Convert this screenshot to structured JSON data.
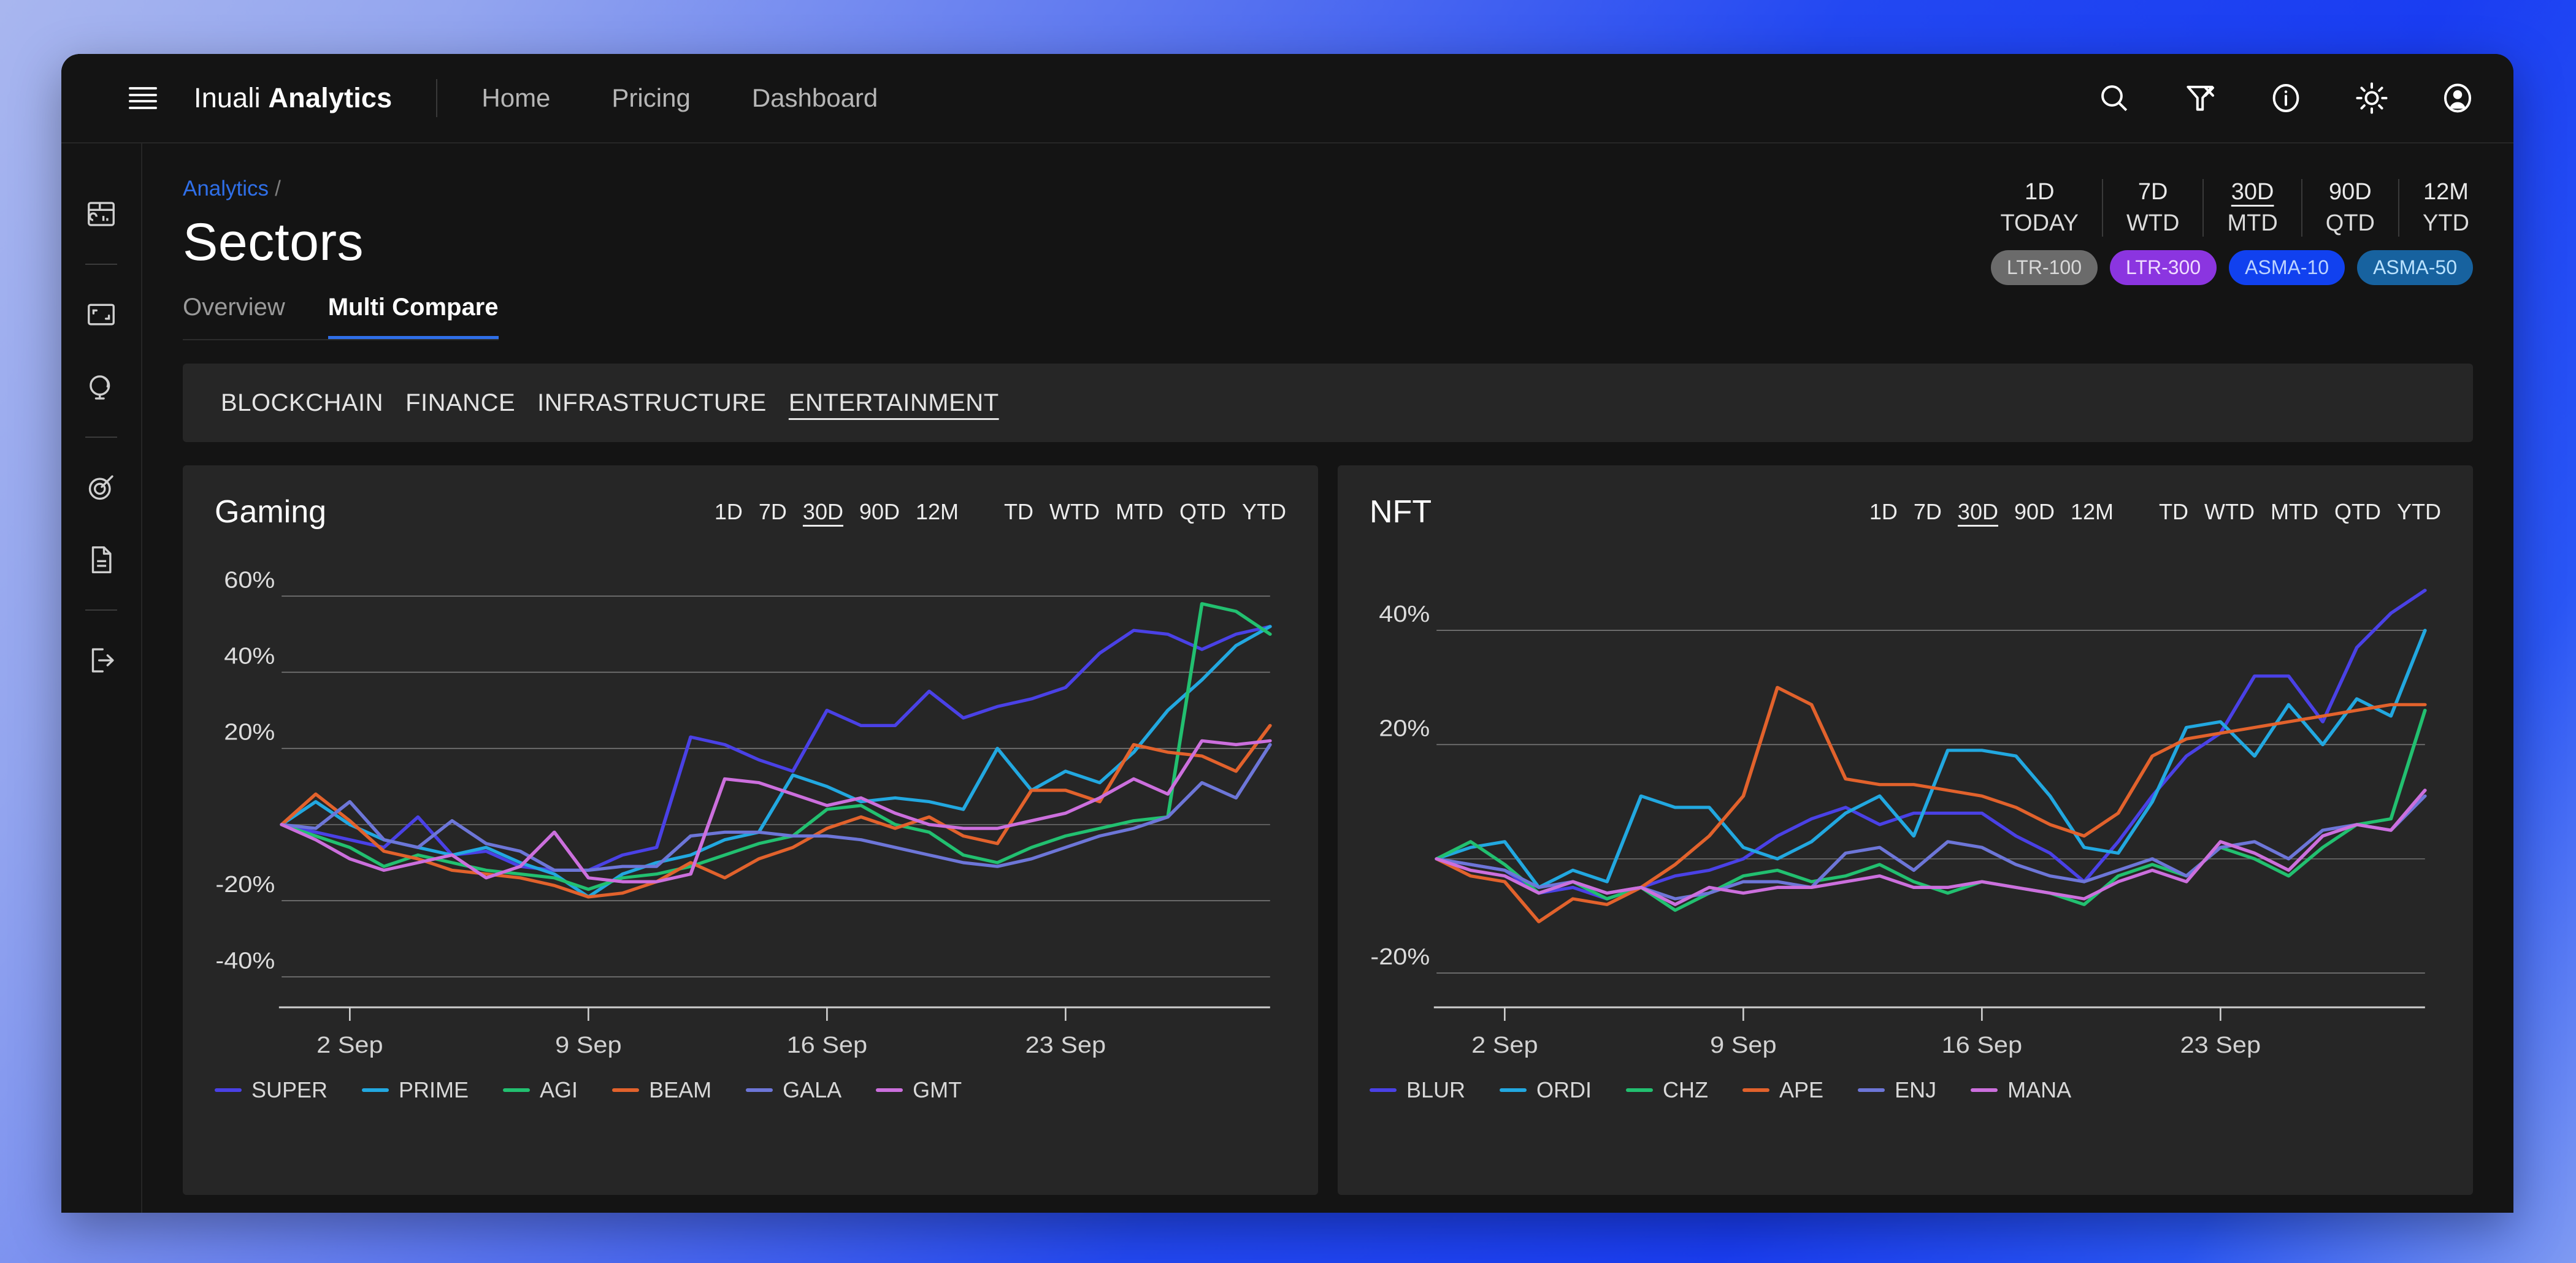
{
  "topbar": {
    "menu_icon": "hamburger-icon",
    "brand_prefix": "Inuali ",
    "brand_bold": "Analytics",
    "nav": [
      {
        "label": "Home"
      },
      {
        "label": "Pricing"
      },
      {
        "label": "Dashboard"
      }
    ],
    "icons": [
      "search-icon",
      "filter-remove-icon",
      "info-icon",
      "sun-icon",
      "account-icon"
    ]
  },
  "sidebar": {
    "items": [
      {
        "icon": "dashboard-layout-icon"
      },
      {
        "icon": "expand-icon"
      },
      {
        "icon": "globe-icon"
      },
      {
        "icon": "target-icon"
      },
      {
        "icon": "document-icon"
      },
      {
        "icon": "logout-icon"
      }
    ]
  },
  "breadcrumb": {
    "root": "Analytics",
    "separator": "/"
  },
  "page": {
    "title": "Sectors",
    "tabs": [
      {
        "label": "Overview",
        "active": false
      },
      {
        "label": "Multi Compare",
        "active": true
      }
    ]
  },
  "range_selector": {
    "columns": [
      {
        "top": "1D",
        "bottom": "TODAY",
        "active": false
      },
      {
        "top": "7D",
        "bottom": "WTD",
        "active": false
      },
      {
        "top": "30D",
        "bottom": "MTD",
        "active": true
      },
      {
        "top": "90D",
        "bottom": "QTD",
        "active": false
      },
      {
        "top": "12M",
        "bottom": "YTD",
        "active": false
      }
    ],
    "badges": [
      {
        "label": "LTR-100",
        "bg": "#6b6b6b",
        "fg": "#d9d9d9"
      },
      {
        "label": "LTR-300",
        "bg": "#8b35e0",
        "fg": "#f0dcff"
      },
      {
        "label": "ASMA-10",
        "bg": "#1141ef",
        "fg": "#bcd3ff"
      },
      {
        "label": "ASMA-50",
        "bg": "#17629f",
        "fg": "#b9e2ff"
      }
    ]
  },
  "categories": [
    {
      "label": "BLOCKCHAIN",
      "active": false
    },
    {
      "label": "FINANCE",
      "active": false
    },
    {
      "label": "INFRASTRUCTURE",
      "active": false
    },
    {
      "label": "ENTERTAINMENT",
      "active": true
    }
  ],
  "card_ranges": {
    "group1": [
      {
        "label": "1D",
        "active": false
      },
      {
        "label": "7D",
        "active": false
      },
      {
        "label": "30D",
        "active": true
      },
      {
        "label": "90D",
        "active": false
      },
      {
        "label": "12M",
        "active": false
      }
    ],
    "group2": [
      {
        "label": "TD",
        "active": false
      },
      {
        "label": "WTD",
        "active": false
      },
      {
        "label": "MTD",
        "active": false
      },
      {
        "label": "QTD",
        "active": false
      },
      {
        "label": "YTD",
        "active": false
      }
    ]
  },
  "series_colors": {
    "s1": "#4a41e6",
    "s2": "#22a8e0",
    "s3": "#22c070",
    "s4": "#e2622c",
    "s5": "#6d76d8",
    "s6": "#cc6fdd"
  },
  "chart_data": [
    {
      "type": "line",
      "title": "Gaming",
      "xlabel": "",
      "ylabel": "",
      "ylim": [
        -48,
        66
      ],
      "yticks": [
        60,
        40,
        20,
        -20,
        -40
      ],
      "ytick_labels": [
        "60%",
        "40%",
        "20%",
        "-20%",
        "-40%"
      ],
      "grid": true,
      "zero_line": true,
      "legend_position": "bottom",
      "x_tick_labels": [
        "2 Sep",
        "9 Sep",
        "16 Sep",
        "23 Sep"
      ],
      "x_tick_index": [
        2,
        9,
        16,
        23
      ],
      "x": [
        0,
        1,
        2,
        3,
        4,
        5,
        6,
        7,
        8,
        9,
        10,
        11,
        12,
        13,
        14,
        15,
        16,
        17,
        18,
        19,
        20,
        21,
        22,
        23,
        24,
        25,
        26,
        27,
        28,
        29
      ],
      "series": [
        {
          "name": "SUPER",
          "color": "#4a41e6",
          "values": [
            0,
            -2,
            -4,
            -6,
            2,
            -8,
            -7,
            -11,
            -12,
            -12,
            -8,
            -6,
            23,
            21,
            17,
            14,
            30,
            26,
            26,
            35,
            28,
            31,
            33,
            36,
            45,
            51,
            50,
            46,
            50,
            52
          ]
        },
        {
          "name": "PRIME",
          "color": "#22a8e0",
          "values": [
            0,
            6,
            0,
            -4,
            -6,
            -8,
            -6,
            -10,
            -13,
            -19,
            -13,
            -10,
            -8,
            -4,
            -2,
            13,
            10,
            6,
            7,
            6,
            4,
            20,
            9,
            14,
            11,
            19,
            30,
            38,
            47,
            52
          ]
        },
        {
          "name": "AGI",
          "color": "#22c070",
          "values": [
            0,
            -3,
            -6,
            -11,
            -8,
            -10,
            -12,
            -13,
            -14,
            -17,
            -14,
            -13,
            -11,
            -8,
            -5,
            -3,
            4,
            5,
            0,
            -2,
            -8,
            -10,
            -6,
            -3,
            -1,
            1,
            2,
            58,
            56,
            50
          ]
        },
        {
          "name": "BEAM",
          "color": "#e2622c",
          "values": [
            0,
            8,
            1,
            -7,
            -9,
            -12,
            -13,
            -14,
            -16,
            -19,
            -18,
            -15,
            -10,
            -14,
            -9,
            -6,
            -1,
            2,
            -1,
            2,
            -3,
            -5,
            9,
            9,
            6,
            21,
            19,
            18,
            14,
            26
          ]
        },
        {
          "name": "GALA",
          "color": "#6d76d8",
          "values": [
            0,
            -1,
            6,
            -4,
            -6,
            1,
            -5,
            -7,
            -12,
            -12,
            -11,
            -11,
            -3,
            -2,
            -2,
            -3,
            -3,
            -4,
            -6,
            -8,
            -10,
            -11,
            -9,
            -6,
            -3,
            -1,
            2,
            11,
            7,
            21
          ]
        },
        {
          "name": "GMT",
          "color": "#cc6fdd",
          "values": [
            0,
            -4,
            -9,
            -12,
            -10,
            -8,
            -14,
            -11,
            -2,
            -14,
            -15,
            -15,
            -13,
            12,
            11,
            8,
            5,
            7,
            3,
            0,
            -1,
            -1,
            1,
            3,
            7,
            12,
            8,
            22,
            21,
            22
          ]
        }
      ]
    },
    {
      "type": "line",
      "title": "NFT",
      "xlabel": "",
      "ylabel": "",
      "ylim": [
        -26,
        50
      ],
      "yticks": [
        40,
        20,
        -20
      ],
      "ytick_labels": [
        "40%",
        "20%",
        "-20%"
      ],
      "grid": true,
      "zero_line": true,
      "legend_position": "bottom",
      "x_tick_labels": [
        "2 Sep",
        "9 Sep",
        "16 Sep",
        "23 Sep"
      ],
      "x_tick_index": [
        2,
        9,
        16,
        23
      ],
      "x": [
        0,
        1,
        2,
        3,
        4,
        5,
        6,
        7,
        8,
        9,
        10,
        11,
        12,
        13,
        14,
        15,
        16,
        17,
        18,
        19,
        20,
        21,
        22,
        23,
        24,
        25,
        26,
        27,
        28,
        29
      ],
      "series": [
        {
          "name": "BLUR",
          "color": "#4a41e6",
          "values": [
            0,
            -1,
            -2,
            -6,
            -5,
            -7,
            -5,
            -3,
            -2,
            0,
            4,
            7,
            9,
            6,
            8,
            8,
            8,
            4,
            1,
            -4,
            3,
            11,
            18,
            22,
            32,
            32,
            24,
            37,
            43,
            47
          ]
        },
        {
          "name": "ORDI",
          "color": "#22a8e0",
          "values": [
            0,
            2,
            3,
            -5,
            -2,
            -4,
            11,
            9,
            9,
            2,
            0,
            3,
            8,
            11,
            4,
            19,
            19,
            18,
            11,
            2,
            1,
            10,
            23,
            24,
            18,
            27,
            20,
            28,
            25,
            40
          ]
        },
        {
          "name": "CHZ",
          "color": "#22c070",
          "values": [
            0,
            3,
            -1,
            -6,
            -4,
            -7,
            -5,
            -9,
            -6,
            -3,
            -2,
            -4,
            -3,
            -1,
            -4,
            -6,
            -4,
            -5,
            -6,
            -8,
            -3,
            -1,
            -3,
            2,
            0,
            -3,
            2,
            6,
            7,
            26
          ]
        },
        {
          "name": "APE",
          "color": "#e2622c",
          "values": [
            0,
            -3,
            -4,
            -11,
            -7,
            -8,
            -5,
            -1,
            4,
            11,
            30,
            27,
            14,
            13,
            13,
            12,
            11,
            9,
            6,
            4,
            8,
            18,
            21,
            22,
            23,
            24,
            25,
            26,
            27,
            27
          ]
        },
        {
          "name": "ENJ",
          "color": "#6d76d8",
          "values": [
            0,
            -1,
            -2,
            -5,
            -4,
            -6,
            -5,
            -7,
            -6,
            -4,
            -4,
            -5,
            1,
            2,
            -2,
            3,
            2,
            -1,
            -3,
            -4,
            -2,
            0,
            -3,
            2,
            3,
            0,
            5,
            6,
            5,
            11
          ]
        },
        {
          "name": "MANA",
          "color": "#cc6fdd",
          "values": [
            0,
            -2,
            -3,
            -6,
            -4,
            -6,
            -5,
            -8,
            -5,
            -6,
            -5,
            -5,
            -4,
            -3,
            -5,
            -5,
            -4,
            -5,
            -6,
            -7,
            -4,
            -2,
            -4,
            3,
            1,
            -2,
            4,
            6,
            5,
            12
          ]
        }
      ]
    }
  ]
}
